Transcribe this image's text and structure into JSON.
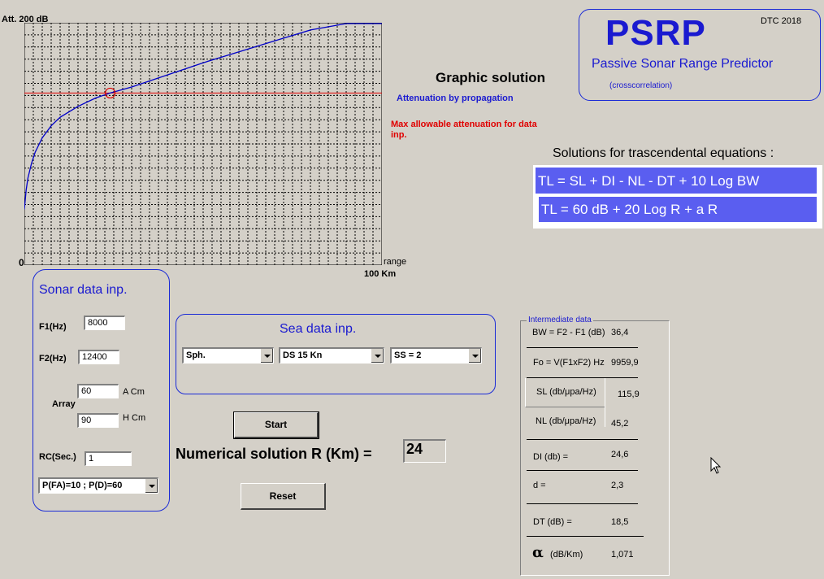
{
  "chart": {
    "y_top_label": "Att. 200 dB",
    "y_zero_label": "0",
    "x_end_label": "range",
    "x_max_label": "100 Km"
  },
  "chart_data": {
    "type": "line",
    "xlim": [
      0,
      100
    ],
    "ylim": [
      0,
      200
    ],
    "grid": true,
    "xlabel": "range",
    "ylabel": "Att.",
    "series": [
      {
        "name": "Attenuation by propagation",
        "color": "#0000c8",
        "x": [
          0,
          0.5,
          1,
          2,
          3,
          5,
          7.5,
          10,
          15,
          20,
          24,
          30,
          40,
          50,
          60,
          70,
          80,
          90,
          99.5,
          100
        ],
        "y": [
          46,
          62,
          72,
          84,
          93,
          105,
          115,
          122,
          131,
          138,
          142,
          147,
          157,
          167,
          176,
          185,
          194,
          203,
          213,
          213
        ]
      }
    ],
    "hline": {
      "name": "Max allowable attenuation for data inp.",
      "y": 142,
      "color": "#e00000"
    },
    "marker": {
      "x": 24,
      "y": 142,
      "color": "#e00000"
    }
  },
  "graphic": {
    "title": "Graphic solution",
    "legend_blue": "Attenuation by propagation",
    "legend_red_line1": "Max allowable attenuation for data",
    "legend_red_line2": "inp."
  },
  "logo": {
    "title": "PSRP",
    "year": "DTC 2018",
    "subtitle": "Passive Sonar Range Predictor",
    "note": "(crosscorrelation)"
  },
  "equations": {
    "heading": "Solutions for trascendental equations :",
    "eq1": "TL = SL + DI - NL - DT + 10 Log BW",
    "eq2": "TL = 60 dB + 20 Log R + a R",
    "bg_color": "#5a5ef0"
  },
  "sonar": {
    "title": "Sonar data inp.",
    "f1_label": "F1(Hz)",
    "f1_value": "8000",
    "f2_label": "F2(Hz)",
    "f2_value": "12400",
    "array_label": "Array",
    "a_value": "60",
    "a_unit": "A Cm",
    "h_value": "90",
    "h_unit": "H Cm",
    "rc_label": "RC(Sec.)",
    "rc_value": "1",
    "prob_select": "P(FA)=10 ; P(D)=60"
  },
  "sea": {
    "title": "Sea data  inp.",
    "spreading": "Sph.",
    "ds": "DS 15 Kn",
    "ss": "SS = 2"
  },
  "buttons": {
    "start": "Start",
    "reset": "Reset"
  },
  "numerical": {
    "label": "Numerical solution  R (Km) =",
    "value": "24"
  },
  "intermediate": {
    "title": "Intermediate data",
    "bw_label": "BW = F2 - F1 (dB)",
    "bw_value": "36,4",
    "fo_label": "Fo = V(F1xF2) Hz",
    "fo_value": "9959,9",
    "sl_label": "SL (db/μpa/Hz)",
    "sl_value": "115,9",
    "nl_label": "NL (db/μpa/Hz)",
    "nl_value": "45,2",
    "di_label": "DI (db) =",
    "di_value": "24,6",
    "d_label": "d  =",
    "d_value": "2,3",
    "dt_label": "DT (dB) =",
    "dt_value": "18,5",
    "alpha_symbol": "α",
    "alpha_label": "(dB/Km)",
    "alpha_value": "1,071"
  }
}
